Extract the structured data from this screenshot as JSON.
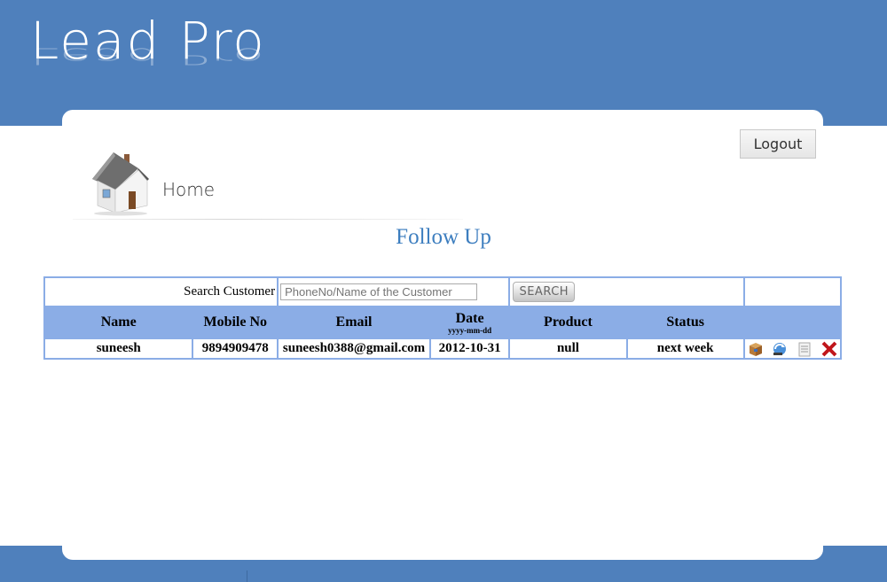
{
  "app": {
    "logo_text": "Lead Pro"
  },
  "header": {
    "logout_label": "Logout"
  },
  "breadcrumb": {
    "home_label": "Home"
  },
  "page": {
    "title": "Follow Up"
  },
  "search": {
    "label": "Search Customer",
    "placeholder": "PhoneNo/Name of the Customer",
    "button_label": "SEARCH"
  },
  "table": {
    "columns": {
      "name": "Name",
      "mobile": "Mobile No",
      "email": "Email",
      "date": "Date",
      "date_format": "yyyy-mm-dd",
      "product": "Product",
      "status": "Status"
    },
    "rows": [
      {
        "name": "suneesh",
        "mobile": "9894909478",
        "email": "suneesh0388@gmail.com",
        "date": "2012-10-31",
        "product": "null",
        "status": "next week"
      }
    ],
    "row_action_icons": [
      "box-icon",
      "refresh-icon",
      "document-icon",
      "delete-icon"
    ]
  },
  "colors": {
    "brand_blue": "#4f80bc",
    "table_header": "#8bade6",
    "title_blue": "#3d7ebf",
    "delete_red": "#c0161b"
  }
}
